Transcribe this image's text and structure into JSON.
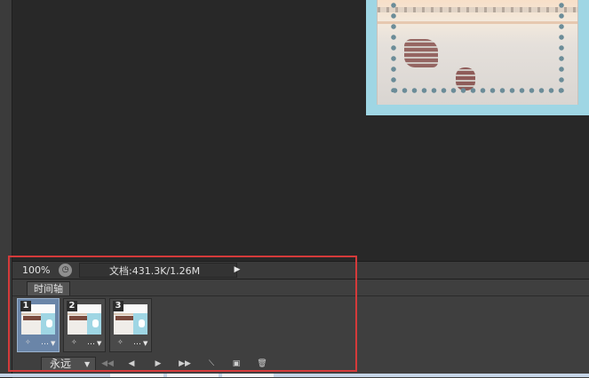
{
  "status_bar": {
    "zoom": "100%",
    "doc_info": "文档:431.3K/1.26M"
  },
  "timeline": {
    "tab_label": "时间轴",
    "frames": [
      {
        "number": "1",
        "delay": "…",
        "selected": true
      },
      {
        "number": "2",
        "delay": "…",
        "selected": false
      },
      {
        "number": "3",
        "delay": "…",
        "selected": false
      }
    ],
    "loop_label": "永远"
  },
  "icons": {
    "zoom_button": "clock-icon",
    "doc_info_arrow": "play-triangle-icon",
    "first_frame": "rewind-icon",
    "prev_frame": "step-back-icon",
    "play": "play-icon",
    "next_frame": "fast-forward-icon",
    "tween": "tween-wand-icon",
    "duplicate": "new-frame-icon",
    "delete": "trash-icon"
  },
  "colors": {
    "highlight_border": "#d53a3a",
    "selected_frame": "#6a85a8",
    "panel": "#3f3f3f",
    "canvas": "#282828"
  }
}
